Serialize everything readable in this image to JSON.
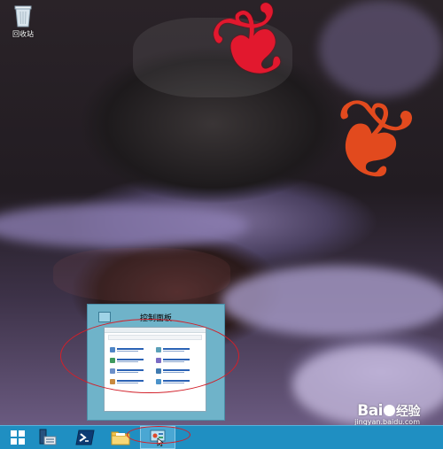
{
  "desktop": {
    "icons": [
      {
        "name": "recycle-bin",
        "label": "回收站"
      }
    ]
  },
  "thumbnail": {
    "title": "控制面板",
    "window_heading": "调整计算机的设置"
  },
  "taskbar": {
    "buttons": [
      {
        "name": "start-button",
        "icon": "windows-logo-icon"
      },
      {
        "name": "server-manager-button",
        "icon": "server-manager-icon"
      },
      {
        "name": "powershell-button",
        "icon": "powershell-icon"
      },
      {
        "name": "file-explorer-button",
        "icon": "folder-icon"
      },
      {
        "name": "control-panel-button",
        "icon": "control-panel-icon",
        "active": true
      }
    ]
  },
  "watermark": {
    "logo_left": "Bai",
    "logo_right": "经验",
    "url": "jingyan.baidu.com"
  },
  "colors": {
    "taskbar": "#1f8fc2",
    "thumbnail_bg": "#6fb3c9",
    "annotation": "#d2202a"
  }
}
